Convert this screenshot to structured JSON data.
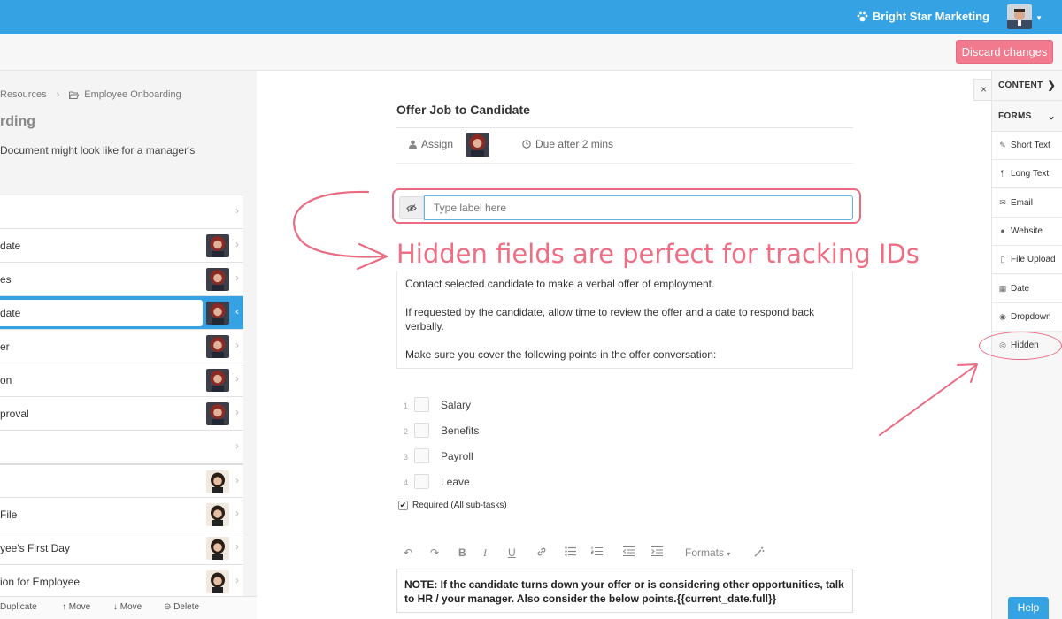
{
  "topbar": {
    "org_name": "Bright Star Marketing",
    "org_icon": "paw-icon",
    "bg_color": "#35a3e3"
  },
  "subbar": {
    "discard_label": "Discard changes",
    "discard_color": "#f27a8e"
  },
  "left": {
    "breadcrumb": [
      "Resources",
      "Employee Onboarding"
    ],
    "title": "rding",
    "description": "Document might look like for a manager's",
    "tasks": [
      {
        "label": "",
        "avatar": false,
        "active": false
      },
      {
        "label": "date",
        "avatar": true,
        "active": false
      },
      {
        "label": "es",
        "avatar": true,
        "active": false
      },
      {
        "label": "date",
        "avatar": true,
        "active": true
      },
      {
        "label": "er",
        "avatar": true,
        "active": false
      },
      {
        "label": "on",
        "avatar": true,
        "active": false
      },
      {
        "label": "proval",
        "avatar": true,
        "active": false
      },
      {
        "label": "",
        "avatar": false,
        "active": false
      },
      {
        "label": "",
        "avatar": true,
        "active": false
      },
      {
        "label": "File",
        "avatar": true,
        "active": false
      },
      {
        "label": "yee's First Day",
        "avatar": true,
        "active": false
      },
      {
        "label": "ion for Employee",
        "avatar": true,
        "active": false
      }
    ],
    "footer": {
      "duplicate": "Duplicate",
      "move_up": "Move",
      "move_down": "Move",
      "delete": "Delete"
    }
  },
  "main": {
    "task_title": "Offer Job to Candidate",
    "assign_label": "Assign",
    "due_label": "Due after 2 mins",
    "label_placeholder": "Type label here",
    "callout": "Hidden fields are perfect for tracking IDs",
    "callout_color": "#ee6e83",
    "description": [
      "Contact selected candidate to make a verbal offer of employment.",
      "If requested by the candidate, allow time to review the offer and a date to respond back verbally.",
      "Make sure you cover the following points in the offer conversation:"
    ],
    "subtasks": [
      {
        "num": "1",
        "label": "Salary"
      },
      {
        "num": "2",
        "label": "Benefits"
      },
      {
        "num": "3",
        "label": "Payroll"
      },
      {
        "num": "4",
        "label": "Leave"
      }
    ],
    "required_label": "Required (All sub-tasks)",
    "toolbar": {
      "formats_label": "Formats"
    },
    "note": "NOTE: If the candidate turns down your offer or is considering other opportunities, talk to HR / your manager. Also consider the below points.{{current_date.full}}"
  },
  "right": {
    "close_label": "×",
    "content_label": "CONTENT",
    "forms_label": "FORMS",
    "items": [
      {
        "label": "Short Text",
        "icon": "edit-icon"
      },
      {
        "label": "Long Text",
        "icon": "paragraph-icon"
      },
      {
        "label": "Email",
        "icon": "envelope-icon"
      },
      {
        "label": "Website",
        "icon": "globe-icon"
      },
      {
        "label": "File Upload",
        "icon": "file-icon"
      },
      {
        "label": "Date",
        "icon": "calendar-icon"
      },
      {
        "label": "Dropdown",
        "icon": "circle-arrow-icon"
      },
      {
        "label": "Hidden",
        "icon": "eye-slash-icon"
      }
    ]
  },
  "help_label": "Help",
  "annotation_color": "#e96b82"
}
